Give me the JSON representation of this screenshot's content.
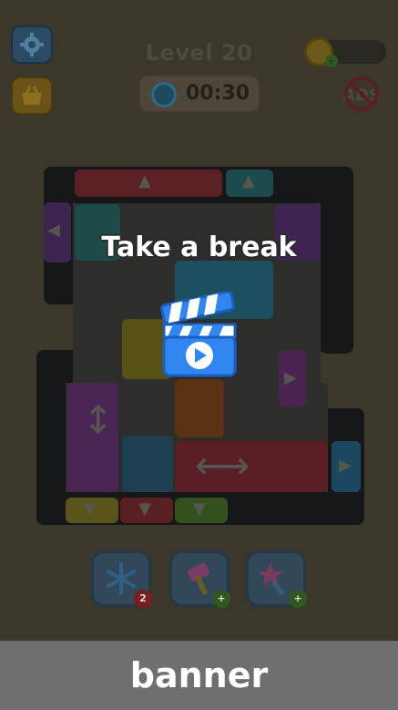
{
  "header": {
    "level_title": "Level 20",
    "timer": "00:30"
  },
  "overlay": {
    "message": "Take a break"
  },
  "tools": [
    {
      "name": "freeze",
      "badge": "2"
    },
    {
      "name": "hammer",
      "badge": "+"
    },
    {
      "name": "magic-wand",
      "badge": "+"
    }
  ],
  "banner": {
    "label": "banner"
  },
  "colors": {
    "dim_background": "#3b372a",
    "banner": "#6f6f6f",
    "clapper_blue": "#2f86f0"
  }
}
